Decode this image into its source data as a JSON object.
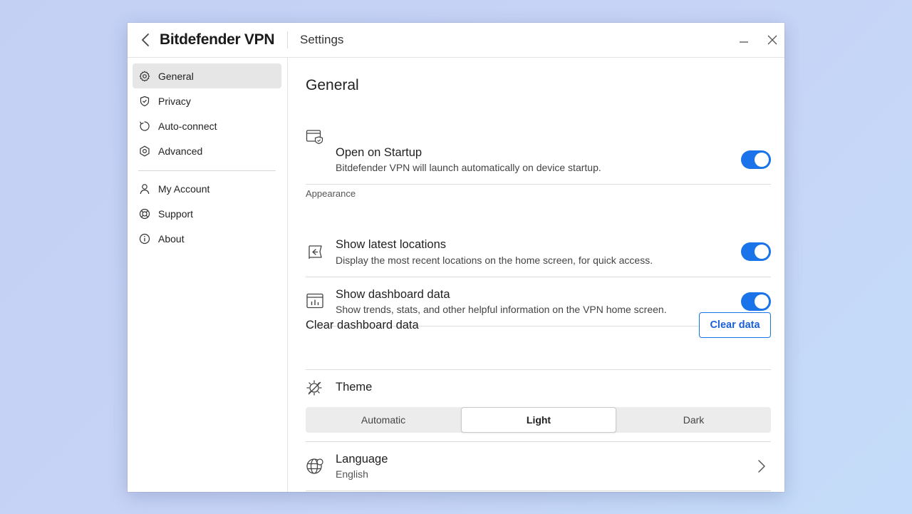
{
  "header": {
    "brand": "Bitdefender VPN",
    "title": "Settings"
  },
  "sidebar": {
    "items": [
      {
        "label": "General",
        "icon": "gear-icon",
        "active": true
      },
      {
        "label": "Privacy",
        "icon": "shield-icon",
        "active": false
      },
      {
        "label": "Auto-connect",
        "icon": "refresh-icon",
        "active": false
      },
      {
        "label": "Advanced",
        "icon": "hexagon-gear-icon",
        "active": false
      },
      {
        "label": "My Account",
        "icon": "user-icon",
        "active": false
      },
      {
        "label": "Support",
        "icon": "lifebuoy-icon",
        "active": false
      },
      {
        "label": "About",
        "icon": "info-icon",
        "active": false
      }
    ]
  },
  "main": {
    "title": "General",
    "startup": {
      "title": "Open on Startup",
      "desc": "Bitdefender VPN will launch automatically on device startup.",
      "enabled": true
    },
    "appearance_label": "Appearance",
    "latest_locations": {
      "title": "Show latest locations",
      "desc": "Display the most recent locations on the home screen, for quick access.",
      "enabled": true
    },
    "dashboard": {
      "title": "Show dashboard data",
      "desc": "Show trends, stats, and other helpful information on the VPN home screen.",
      "enabled": true
    },
    "clear": {
      "label": "Clear dashboard data",
      "button": "Clear data"
    },
    "theme": {
      "label": "Theme",
      "options": [
        "Automatic",
        "Light",
        "Dark"
      ],
      "selected": "Light"
    },
    "language": {
      "label": "Language",
      "value": "English"
    }
  },
  "colors": {
    "accent": "#1a73e8",
    "background_gradient": "#c3d0f4"
  }
}
